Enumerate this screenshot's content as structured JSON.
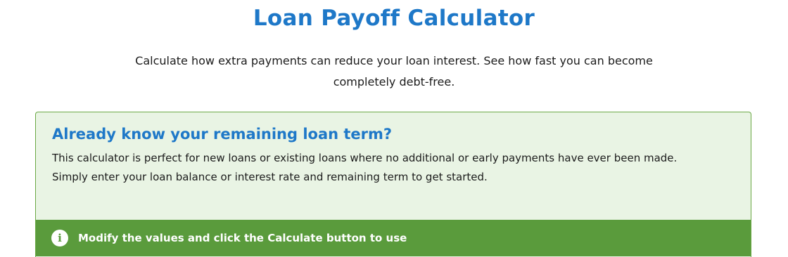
{
  "header": {
    "title": "Loan Payoff Calculator",
    "intro_line1": "Calculate how extra payments can reduce your loan interest. See how fast you can become",
    "intro_line2": "completely debt-free."
  },
  "info_box": {
    "heading": "Already know your remaining loan term?",
    "text_line1": "This calculator is perfect for new loans or existing loans where no additional or early payments have ever been made.",
    "text_line2": "Simply enter your loan balance or interest rate and remaining term to get started."
  },
  "notice": {
    "icon": "info-icon",
    "icon_glyph": "i",
    "text": "Modify the values and click the Calculate button to use"
  },
  "colors": {
    "title_blue": "#1e78c8",
    "box_background": "#e9f4e4",
    "box_border": "#6aa844",
    "notice_green": "#5a9b3c"
  }
}
